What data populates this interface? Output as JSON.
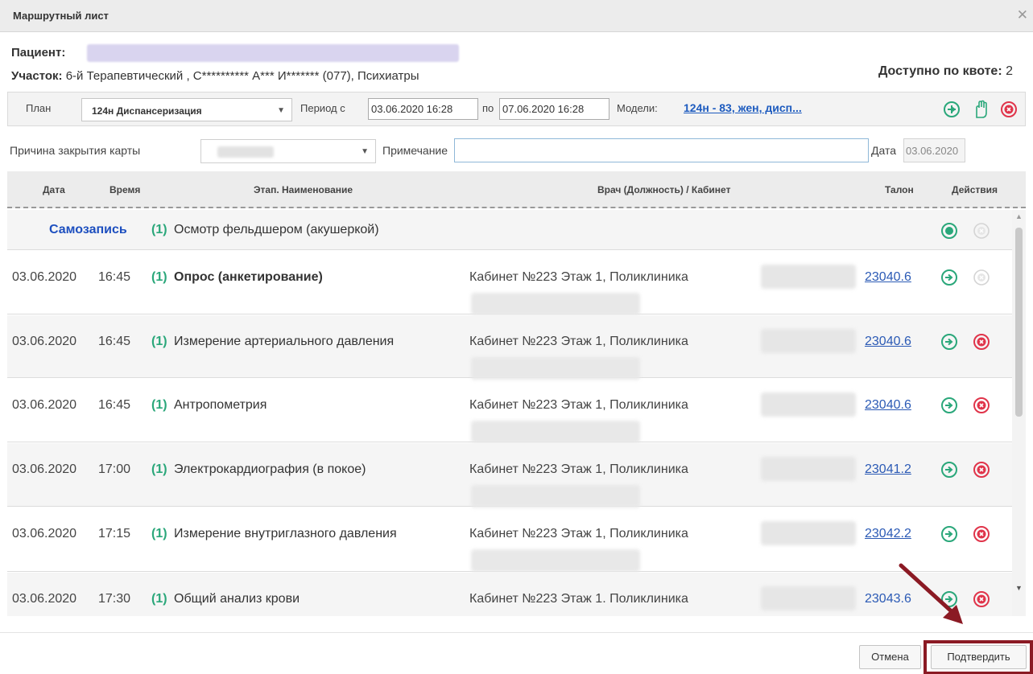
{
  "window": {
    "title": "Маршрутный лист"
  },
  "patient": {
    "label": "Пациент:",
    "uchastok_label": "Участок:",
    "uchastok_value": "6-й Терапевтический , С********** А*** И******* (077), Психиатры",
    "quota_label": "Доступно по квоте:",
    "quota_value": "2"
  },
  "plan_bar": {
    "plan_label": "План",
    "plan_value": "124н Диспансеризация",
    "period_label": "Период с",
    "period_from": "03.06.2020 16:28",
    "period_to_label": "по",
    "period_to": "07.06.2020 16:28",
    "models_label": "Модели:",
    "models_link": "124н - 83, жен, дисп..."
  },
  "close_bar": {
    "reason_label": "Причина закрытия карты",
    "note_label": "Примечание",
    "note_value": "",
    "date_label": "Дата",
    "date_value": "03.06.2020"
  },
  "table": {
    "headers": {
      "date": "Дата",
      "time": "Время",
      "stage": "Этап. Наименование",
      "doctor": "Врач (Должность) / Кабинет",
      "talon": "Талон",
      "actions": "Действия"
    },
    "self_row": {
      "label": "Самозапись",
      "num": "(1)",
      "name": "Осмотр фельдшером (акушеркой)"
    },
    "rows": [
      {
        "date": "03.06.2020",
        "time": "16:45",
        "num": "(1)",
        "name": "Опрос (анкетирование)",
        "cabinet": "Кабинет №223 Этаж 1, Поликлиника",
        "talon": "23040.6"
      },
      {
        "date": "03.06.2020",
        "time": "16:45",
        "num": "(1)",
        "name": "Измерение артериального давления",
        "cabinet": "Кабинет №223 Этаж 1, Поликлиника",
        "talon": "23040.6"
      },
      {
        "date": "03.06.2020",
        "time": "16:45",
        "num": "(1)",
        "name": "Антропометрия",
        "cabinet": "Кабинет №223 Этаж 1, Поликлиника",
        "talon": "23040.6"
      },
      {
        "date": "03.06.2020",
        "time": "17:00",
        "num": "(1)",
        "name": "Электрокардиография (в покое)",
        "cabinet": "Кабинет №223 Этаж 1, Поликлиника",
        "talon": "23041.2"
      },
      {
        "date": "03.06.2020",
        "time": "17:15",
        "num": "(1)",
        "name": "Измерение внутриглазного давления",
        "cabinet": "Кабинет №223 Этаж 1, Поликлиника",
        "talon": "23042.2"
      },
      {
        "date": "03.06.2020",
        "time": "17:30",
        "num": "(1)",
        "name": "Общий анализ крови",
        "cabinet": "Кабинет №223 Этаж 1. Поликлиника",
        "talon": "23043.6"
      }
    ]
  },
  "footer": {
    "cancel_label": "Отмена",
    "confirm_label": "Подтвердить"
  },
  "colors": {
    "accent_green": "#2aa77a",
    "danger_red": "#e0344a",
    "link_blue": "#2b5ab5",
    "annotation": "#8b1a24"
  },
  "icons": [
    "close-icon",
    "add-circle-icon",
    "hand-icon",
    "cancel-circle-icon",
    "record-icon",
    "go-arrow-icon",
    "dropdown-arrow-icon"
  ]
}
